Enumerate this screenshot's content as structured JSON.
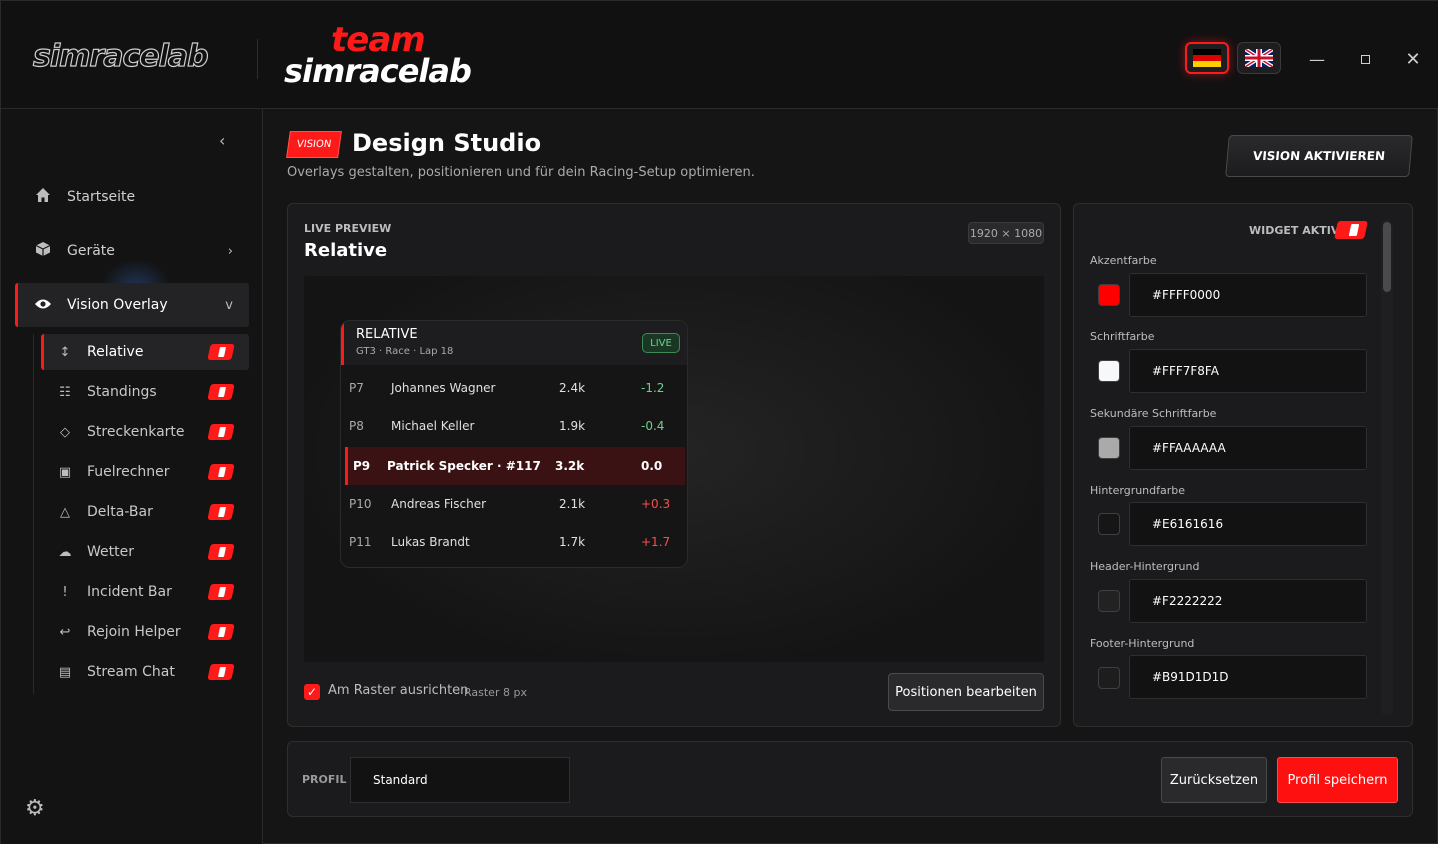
{
  "titlebar": {
    "logo_primary": "simracelab",
    "logo_team_top": "team",
    "logo_team_bottom": "simracelab",
    "lang_de": "german-flag-icon",
    "lang_en": "uk-flag-icon"
  },
  "sidebar": {
    "items": [
      {
        "label": "Startseite",
        "icon": "home-icon"
      },
      {
        "label": "Geräte",
        "icon": "cube-icon"
      },
      {
        "label": "Vision Overlay",
        "icon": "eye-icon"
      }
    ],
    "sub_items": [
      {
        "label": "Relative",
        "icon": "updown-icon",
        "glyph": "↕"
      },
      {
        "label": "Standings",
        "icon": "list-icon",
        "glyph": "☷"
      },
      {
        "label": "Streckenkarte",
        "icon": "diamond-icon",
        "glyph": "◇"
      },
      {
        "label": "Fuelrechner",
        "icon": "fuel-icon",
        "glyph": "▣"
      },
      {
        "label": "Delta-Bar",
        "icon": "triangle-icon",
        "glyph": "△"
      },
      {
        "label": "Wetter",
        "icon": "cloud-icon",
        "glyph": "☁"
      },
      {
        "label": "Incident Bar",
        "icon": "exclamation-icon",
        "glyph": "!"
      },
      {
        "label": "Rejoin Helper",
        "icon": "return-icon",
        "glyph": "↩"
      },
      {
        "label": "Stream Chat",
        "icon": "chat-icon",
        "glyph": "▤"
      }
    ]
  },
  "header": {
    "badge": "VISION",
    "title": "Design Studio",
    "subtitle": "Overlays gestalten, positionieren und für dein Racing-Setup optimieren.",
    "activate_label": "VISION AKTIVIEREN"
  },
  "preview": {
    "label": "LIVE PREVIEW",
    "title": "Relative",
    "resolution": "1920 × 1080",
    "overlay": {
      "title": "RELATIVE",
      "subtitle": "GT3 · Race · Lap 18",
      "live": "LIVE",
      "rows": [
        {
          "pos": "P7",
          "name": "Johannes Wagner",
          "ir": "2.4k",
          "gap": "-1.2"
        },
        {
          "pos": "P8",
          "name": "Michael Keller",
          "ir": "1.9k",
          "gap": "-0.4"
        },
        {
          "pos": "P9",
          "name": "Patrick Specker · #117",
          "ir": "3.2k",
          "gap": "0.0"
        },
        {
          "pos": "P10",
          "name": "Andreas Fischer",
          "ir": "2.1k",
          "gap": "+0.3"
        },
        {
          "pos": "P11",
          "name": "Lukas Brandt",
          "ir": "1.7k",
          "gap": "+1.7"
        }
      ]
    },
    "snap_label": "Am Raster ausrichten",
    "snap_hint": "· Raster 8 px",
    "edit_positions": "Positionen bearbeiten"
  },
  "props": {
    "widget_active": "WIDGET AKTIV",
    "colors": [
      {
        "label": "Akzentfarbe",
        "value": "#FFFF0000",
        "swatch": "#ff0000"
      },
      {
        "label": "Schriftfarbe",
        "value": "#FFF7F8FA",
        "swatch": "#f7f8fa"
      },
      {
        "label": "Sekundäre Schriftfarbe",
        "value": "#FFAAAAAA",
        "swatch": "#aaaaaa"
      },
      {
        "label": "Hintergrundfarbe",
        "value": "#E6161616",
        "swatch": "#161616"
      },
      {
        "label": "Header-Hintergrund",
        "value": "#F2222222",
        "swatch": "#222222"
      },
      {
        "label": "Footer-Hintergrund",
        "value": "#B91D1D1D",
        "swatch": "#1d1d1d"
      }
    ]
  },
  "footer": {
    "profile_label": "PROFIL",
    "profile_value": "Standard",
    "reset": "Zurücksetzen",
    "save": "Profil speichern"
  }
}
